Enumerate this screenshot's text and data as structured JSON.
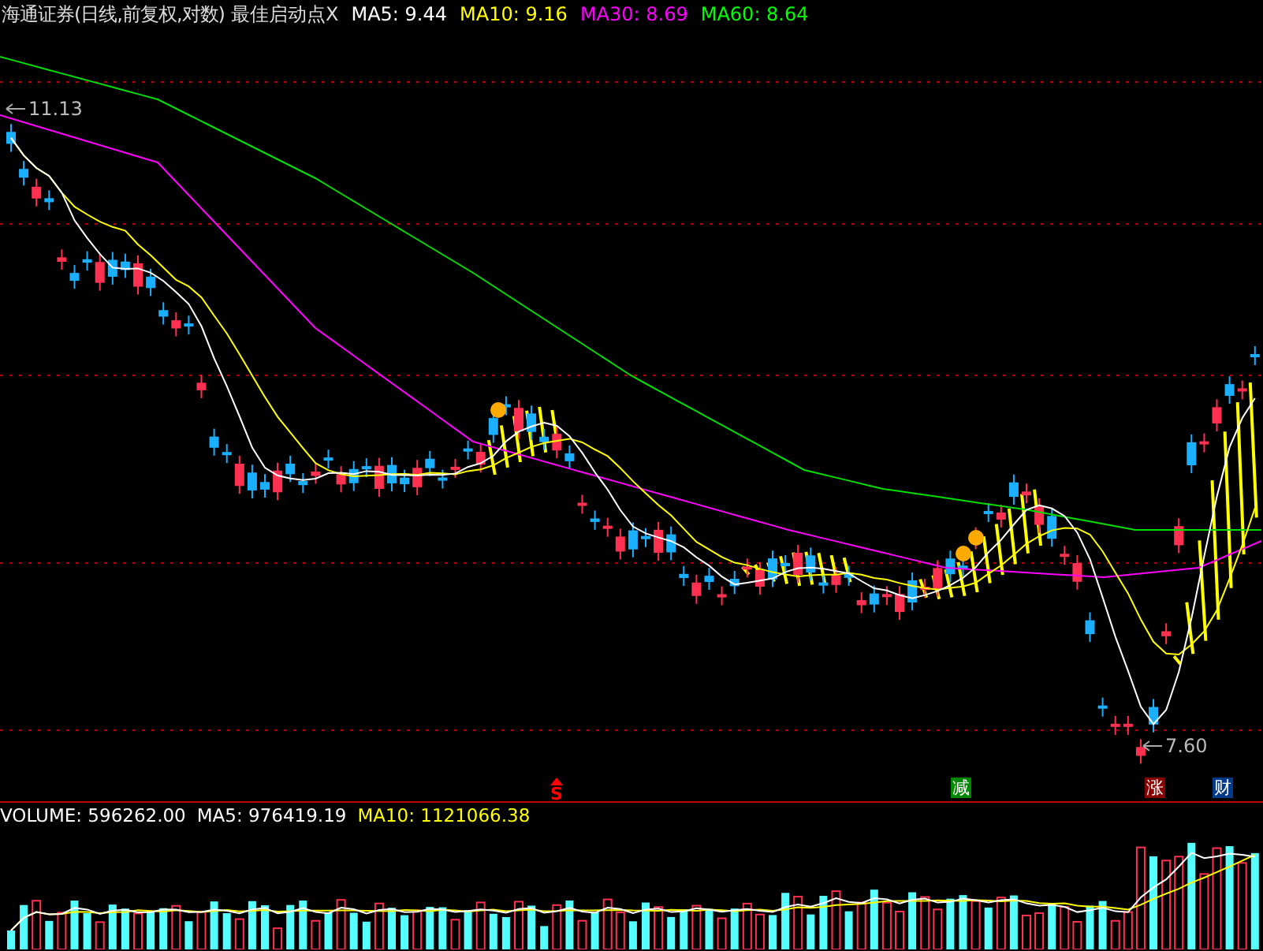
{
  "header": {
    "security": "海通证券(日线,前复权,对数)",
    "indicator": "最佳启动点X",
    "ma": [
      {
        "label": "MA5: 9.44",
        "color": "#ffffff"
      },
      {
        "label": "MA10: 9.16",
        "color": "#ffff00"
      },
      {
        "label": "MA30: 8.69",
        "color": "#ff00ff"
      },
      {
        "label": "MA60: 8.64",
        "color": "#00ff00"
      }
    ]
  },
  "price_chart": {
    "high_label": "11.13",
    "low_label": "7.60",
    "markers": [
      {
        "text": "S",
        "kind": "arrow",
        "color": "#ff0000"
      },
      {
        "text": "减",
        "kind": "box",
        "color": "#008800"
      },
      {
        "text": "涨",
        "kind": "box",
        "color": "#880000"
      },
      {
        "text": "财",
        "kind": "box",
        "color": "#003a88"
      }
    ]
  },
  "volume_panel": {
    "readings": [
      {
        "label": "VOLUME: 596262.00",
        "color": "#ffffff"
      },
      {
        "label": "MA5: 976419.19",
        "color": "#ffffff"
      },
      {
        "label": "MA10: 1121066.38",
        "color": "#ffff00"
      }
    ]
  }
}
